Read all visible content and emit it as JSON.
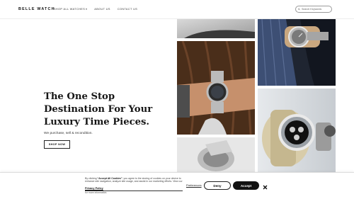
{
  "header": {
    "brand": "BELLE WATCH",
    "nav": [
      {
        "label": "SHOP ALL WATCHES",
        "has_caret": true
      },
      {
        "label": "ABOUT US"
      },
      {
        "label": "CONTACT US"
      }
    ],
    "search": {
      "placeholder": "Search Keywords"
    }
  },
  "hero": {
    "title_lines": [
      "The One Stop",
      "Destination For Your",
      "Luxury Time Pieces."
    ],
    "subtitle": "We purchase, sell & recondition.",
    "cta_label": "SHOP NOW"
  },
  "cookie_banner": {
    "text_prefix": "By clicking ",
    "text_bold": "“Accept All Cookies”",
    "text_rest": ", you agree to the storing of cookies on your device to enhance site navigation, analyze site usage, and assist in our marketing efforts. View our",
    "policy_label": "Privacy Policy",
    "more_info": "for more information.",
    "preferences_label": "Preferences",
    "deny_label": "Deny",
    "accept_label": "Accept"
  },
  "colors": {
    "accent": "#121212",
    "background": "#ffffff"
  },
  "icons": {
    "search": "search-icon",
    "caret": "chevron-down-icon",
    "close": "close-icon"
  }
}
